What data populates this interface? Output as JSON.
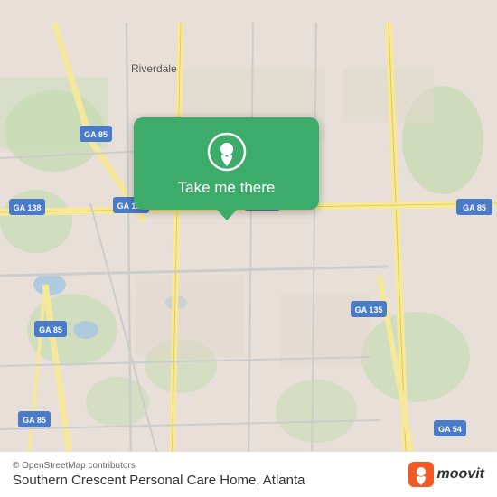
{
  "map": {
    "background_color": "#e8e0d8",
    "center_label": "Riverdale",
    "road_labels": [
      "GA 85",
      "GA 138",
      "GA 138",
      "GA 138",
      "GA 85",
      "GA 85",
      "GA 135",
      "GA 54"
    ],
    "attribution": "© OpenStreetMap contributors",
    "location_name": "Southern Crescent Personal Care Home, Atlanta"
  },
  "popup": {
    "label": "Take me there",
    "pin_color": "white",
    "background_color": "#3dac6a"
  },
  "moovit": {
    "text": "moovit"
  }
}
